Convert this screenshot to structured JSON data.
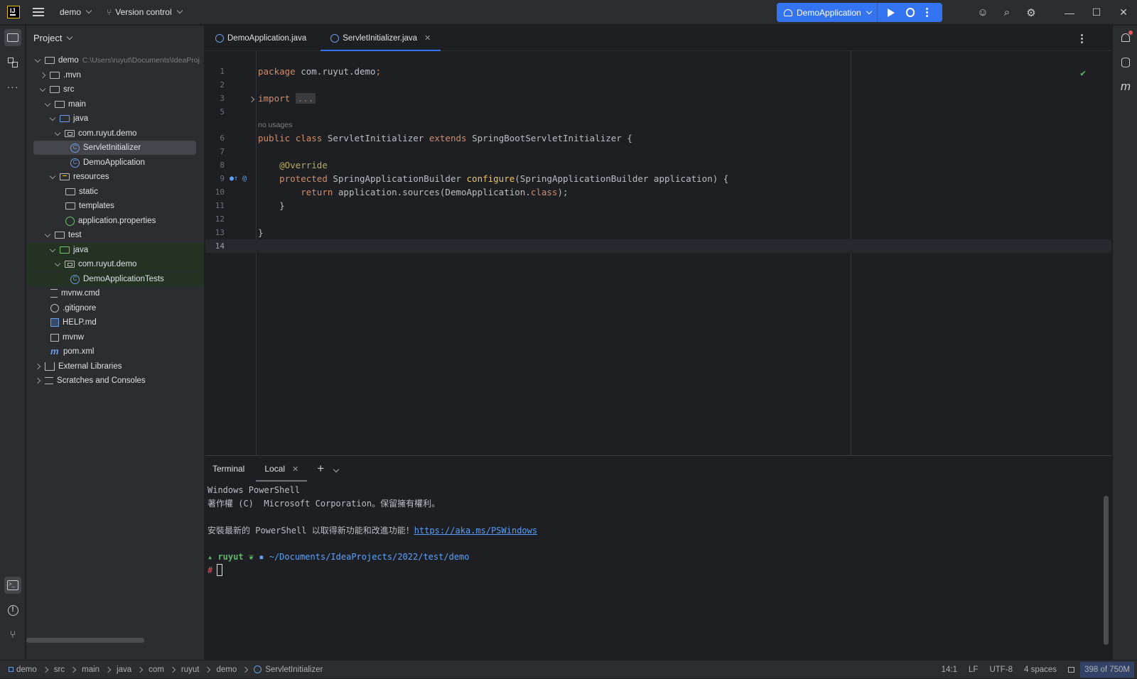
{
  "titlebar": {
    "project_name": "demo",
    "vcs_label": "Version control",
    "run_config": "DemoApplication",
    "icons": [
      "main-menu-icon",
      "branch-icon",
      "run-icon",
      "debug-icon",
      "more-icon",
      "add-user-icon",
      "search-icon",
      "settings-icon",
      "minimize-icon",
      "maximize-icon",
      "close-icon"
    ]
  },
  "project_panel": {
    "title": "Project",
    "root_name": "demo",
    "root_path": "C:\\Users\\ruyut\\Documents\\IdeaProj",
    "items": [
      {
        "label": ".mvn"
      },
      {
        "label": "src"
      },
      {
        "label": "main"
      },
      {
        "label": "java"
      },
      {
        "label": "com.ruyut.demo"
      },
      {
        "label": "ServletInitializer"
      },
      {
        "label": "DemoApplication"
      },
      {
        "label": "resources"
      },
      {
        "label": "static"
      },
      {
        "label": "templates"
      },
      {
        "label": "application.properties"
      },
      {
        "label": "test"
      },
      {
        "label": "java"
      },
      {
        "label": "com.ruyut.demo"
      },
      {
        "label": "DemoApplicationTests"
      },
      {
        "label": "mvnw.cmd"
      },
      {
        "label": ".gitignore"
      },
      {
        "label": "HELP.md"
      },
      {
        "label": "mvnw"
      },
      {
        "label": "pom.xml"
      },
      {
        "label": "External Libraries"
      },
      {
        "label": "Scratches and Consoles"
      }
    ]
  },
  "editor": {
    "tabs": [
      {
        "label": "DemoApplication.java",
        "active": false
      },
      {
        "label": "ServletInitializer.java",
        "active": true
      }
    ],
    "line_numbers": [
      "1",
      "2",
      "3",
      "5",
      "6",
      "7",
      "8",
      "9",
      "10",
      "11",
      "12",
      "13",
      "14"
    ],
    "hint_no_usages": "no usages",
    "code": {
      "l1_kw": "package",
      "l1_rest": " com.ruyut.demo",
      "l1_semi": ";",
      "l3_kw": "import",
      "l3_fold": "...",
      "l6_kw1": "public",
      "l6_kw2": "class",
      "l6_name": "ServletInitializer",
      "l6_kw3": "extends",
      "l6_super": "SpringBootServletInitializer {",
      "l8_ann": "@Override",
      "l9_kw": "protected",
      "l9_type": "SpringApplicationBuilder",
      "l9_fn": "configure",
      "l9_params": "(SpringApplicationBuilder application) {",
      "l10_kw": "return",
      "l10_rest": " application.sources(DemoApplication.",
      "l10_kw2": "class",
      "l10_end": ");",
      "l11": "}",
      "l13": "}"
    }
  },
  "terminal": {
    "title": "Terminal",
    "tab_label": "Local",
    "lines": {
      "l1": "Windows PowerShell",
      "l2": "著作權 (C)  Microsoft Corporation。保留擁有權利。",
      "l3_text": "安裝最新的 PowerShell 以取得新功能和改進功能！",
      "l3_link": "https://aka.ms/PSWindows",
      "prompt_user": "ruyut",
      "prompt_path": "~/Documents/IdeaProjects/2022/test/demo",
      "prompt_hash": "#"
    }
  },
  "statusbar": {
    "breadcrumbs": [
      "demo",
      "src",
      "main",
      "java",
      "com",
      "ruyut",
      "demo",
      "ServletInitializer"
    ],
    "position": "14:1",
    "line_sep": "LF",
    "encoding": "UTF-8",
    "indent": "4 spaces",
    "memory": "398 of 750M"
  },
  "colors": {
    "accent": "#3574f0",
    "background": "#1e1f22",
    "panel": "#2b2d30"
  }
}
